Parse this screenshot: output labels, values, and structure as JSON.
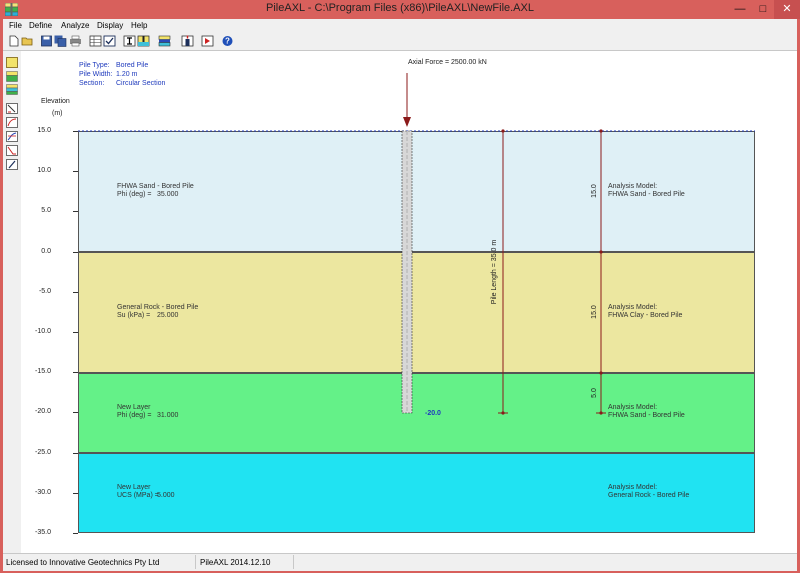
{
  "window": {
    "title": "PileAXL  -  C:\\Program Files (x86)\\PileAXL\\NewFile.AXL",
    "min_glyph": "—",
    "max_glyph": "□",
    "close_glyph": "✕"
  },
  "menu": [
    "File",
    "Define",
    "Analyze",
    "Display",
    "Help"
  ],
  "pile_info": {
    "type_label": "Pile Type:",
    "type_value": "Bored Pile",
    "width_label": "Pile Width:",
    "width_value": "1.20 m",
    "section_label": "Section:",
    "section_value": "Circular Section"
  },
  "axial_force": "Axial Force = 2500.00 kN",
  "elevation_label": "Elevation",
  "elevation_unit": "(m)",
  "elevation_ticks": [
    "15.0",
    "10.0",
    "5.0",
    "0.0",
    "-5.0",
    "-10.0",
    "-15.0",
    "-20.0",
    "-25.0",
    "-30.0",
    "-35.0"
  ],
  "layers": [
    {
      "name": "FHWA Sand - Bored Pile",
      "param_label": "Phi (deg) =",
      "param_value": "35.000",
      "analysis_label": "Analysis Model:",
      "analysis_model": "FHWA Sand - Bored Pile",
      "color": "#dff0f6"
    },
    {
      "name": "General Rock - Bored Pile",
      "param_label": "Su (kPa) =",
      "param_value": "25.000",
      "analysis_label": "Analysis Model:",
      "analysis_model": "FHWA Clay - Bored Pile",
      "color": "#ece7a0"
    },
    {
      "name": "New Layer",
      "param_label": "Phi (deg) =",
      "param_value": "31.000",
      "analysis_label": "Analysis Model:",
      "analysis_model": "FHWA Sand - Bored Pile",
      "color": "#64f188"
    },
    {
      "name": "New Layer",
      "param_label": "UCS (MPa) =",
      "param_value": "5.000",
      "analysis_label": "Analysis Model:",
      "analysis_model": "General Rock - Bored Pile",
      "color": "#20e3f2"
    }
  ],
  "pile_tip": "-20.0",
  "pile_length": "Pile Length = 35.0 m",
  "segment_labels": [
    "15.0",
    "15.0",
    "5.0"
  ],
  "status": {
    "license": "Licensed to Innovative Geotechnics Pty Ltd",
    "version": "PileAXL  2014.12.10"
  },
  "colors": {
    "title_bar": "#d8605c",
    "dim_line": "#8b1a1a",
    "label_blue": "#1f3bbd"
  },
  "toolbar_icons": [
    "new-file-icon",
    "open-folder-icon",
    "save-icon",
    "save-all-icon",
    "print-icon",
    "table-icon",
    "checkbox-icon",
    "pile-icon",
    "layers-icon",
    "profile-icon",
    "load-icon",
    "run-icon",
    "help-icon"
  ],
  "side_icons": [
    "pile-type-icon",
    "soil-layers-icon",
    "soil-grid-icon",
    "curve-t-z-icon",
    "curve-q-z-icon",
    "curve-3-icon",
    "curve-4-icon",
    "curve-5-icon"
  ]
}
